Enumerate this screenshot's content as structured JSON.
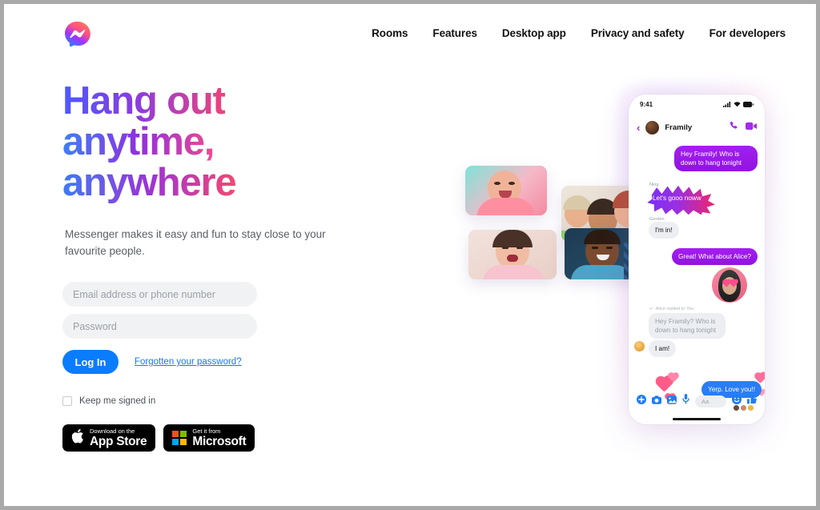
{
  "brand": {
    "logo_icon": "messenger-logo-icon",
    "accent_blue": "#0a7cff",
    "link_blue": "#1877f2",
    "gradient_start": "#3b82f6",
    "gradient_mid": "#9030e0",
    "gradient_end": "#f0447a"
  },
  "nav": {
    "items": [
      {
        "label": "Rooms"
      },
      {
        "label": "Features"
      },
      {
        "label": "Desktop app"
      },
      {
        "label": "Privacy and safety"
      },
      {
        "label": "For developers"
      }
    ]
  },
  "hero": {
    "headline_line1": "Hang out",
    "headline_line2": "anytime,",
    "headline_line3": "anywhere",
    "subtitle": "Messenger makes it easy and fun to stay close to your favourite people."
  },
  "login": {
    "email_placeholder": "Email address or phone number",
    "email_value": "",
    "password_placeholder": "Password",
    "password_value": "",
    "login_label": "Log In",
    "forgot_label": "Forgotten your password?",
    "keep_signed_in_label": "Keep me signed in",
    "keep_signed_in_checked": false
  },
  "store_badges": [
    {
      "small": "Download on the",
      "big": "App Store",
      "icon": "apple-icon"
    },
    {
      "small": "Get it from",
      "big": "Microsoft",
      "icon": "microsoft-icon"
    }
  ],
  "phone": {
    "status": {
      "time": "9:41",
      "signal_icon": "signal-icon",
      "wifi_icon": "wifi-icon",
      "battery_icon": "battery-icon"
    },
    "chat_header": {
      "back_icon": "back-chevron-icon",
      "avatar": "group-avatar",
      "title": "Framily",
      "call_icon": "phone-call-icon",
      "video_icon": "video-call-icon"
    },
    "messages": [
      {
        "id": "m1",
        "from": "me",
        "text": "Hey Framily! Who is down to hang tonight",
        "style": "purple"
      },
      {
        "id": "m-ning",
        "from": "Ning",
        "sender_label": "Ning",
        "text": "Let's gooo noww",
        "style": "burst"
      },
      {
        "id": "m-gordon",
        "from": "Gordon",
        "sender_label": "Gordon",
        "text": "I'm in!",
        "style": "gray"
      },
      {
        "id": "m3",
        "from": "me",
        "text": "Great! What about Alice?",
        "style": "purple"
      },
      {
        "id": "m-reply-meta",
        "from": "Alice",
        "text": "Alice replied to You",
        "style": "meta"
      },
      {
        "id": "m-quoted",
        "from": "Alice",
        "text": "Hey Framily? Who is down to hang tonight",
        "style": "quoted"
      },
      {
        "id": "m4",
        "from": "Alice",
        "text": "I am!",
        "style": "gray"
      },
      {
        "id": "m5",
        "from": "me",
        "text": "Yerp. Love you!!",
        "style": "blue"
      }
    ],
    "composer": {
      "plus_icon": "plus-icon",
      "camera_icon": "camera-icon",
      "gallery_icon": "gallery-icon",
      "mic_icon": "microphone-icon",
      "input_placeholder": "Aa",
      "emoji_icon": "emoji-icon",
      "like_icon": "thumbs-up-icon"
    }
  },
  "collage": {
    "tiles": [
      {
        "id": "tile-1",
        "label": "video-tile-person-1"
      },
      {
        "id": "tile-2",
        "label": "video-tile-group"
      },
      {
        "id": "tile-3",
        "label": "video-tile-person-2"
      },
      {
        "id": "tile-4",
        "label": "video-tile-person-3"
      }
    ]
  }
}
